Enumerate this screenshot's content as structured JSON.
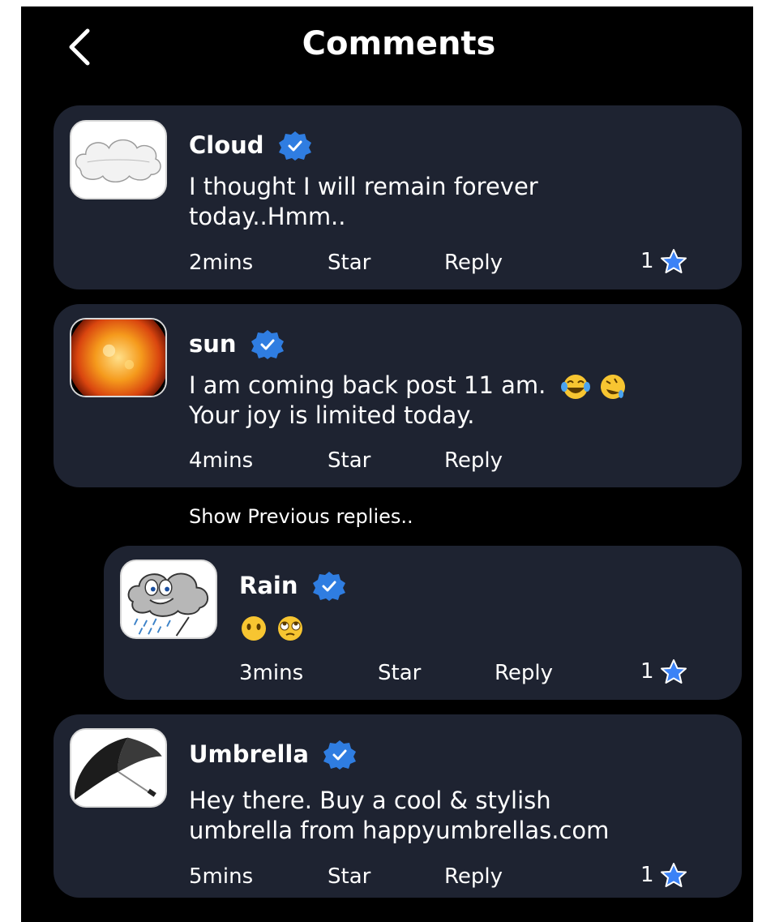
{
  "header": {
    "title": "Comments",
    "back_icon": "chevron-left-icon"
  },
  "comments": [
    {
      "author": "Cloud",
      "text_line1": "I thought I will remain forever",
      "text_line2": "today..Hmm..",
      "time": "2mins",
      "star_label": "Star",
      "reply_label": "Reply",
      "star_count": "1"
    },
    {
      "author": "sun",
      "text_line1": "I am coming back  post 11 am.",
      "text_line2": "Your joy is limited today.",
      "time": "4mins",
      "star_label": "Star",
      "reply_label": "Reply"
    },
    {
      "author": "Umbrella",
      "text_line1": "Hey there. Buy a cool & stylish",
      "text_line2": "umbrella from happyumbrellas.com",
      "time": "5mins",
      "star_label": "Star",
      "reply_label": "Reply",
      "star_count": "1"
    }
  ],
  "show_previous": "Show Previous replies..",
  "reply": {
    "author": "Rain",
    "time": "3mins",
    "star_label": "Star",
    "reply_label": "Reply",
    "star_count": "1"
  },
  "colors": {
    "background": "#000000",
    "card": "#1e2331",
    "verified": "#2f7de1",
    "star": "#3b82f6",
    "text": "#ffffff"
  }
}
